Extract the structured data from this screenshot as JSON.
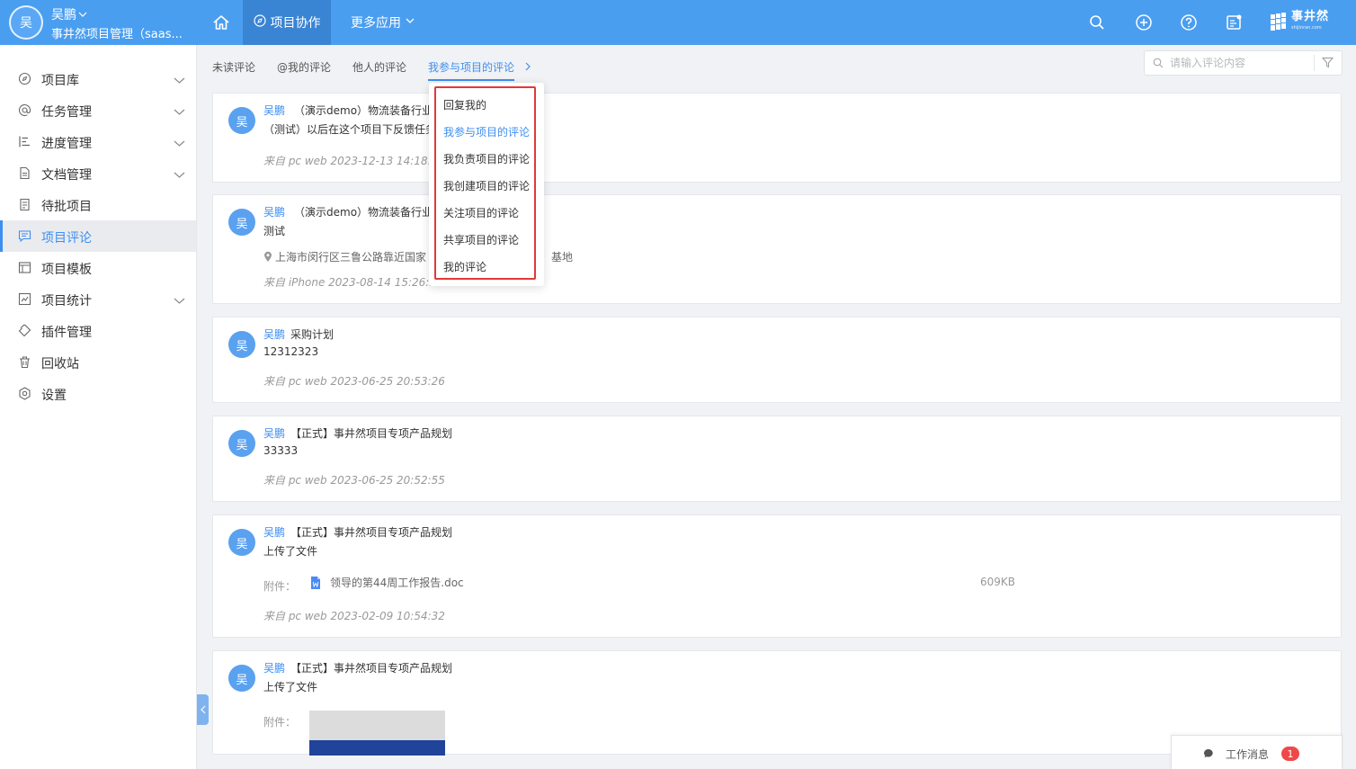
{
  "header": {
    "avatar_char": "吴",
    "user_name": "吴鹏",
    "org_name": "事井然项目管理（saas...",
    "nav_collab": "项目协作",
    "nav_more": "更多应用",
    "brand": "事井然",
    "brand_sub": "shijinran.com"
  },
  "sidebar": {
    "items": [
      {
        "label": "项目库",
        "icon": "compass-icon"
      },
      {
        "label": "任务管理",
        "icon": "at-icon"
      },
      {
        "label": "进度管理",
        "icon": "gantt-icon"
      },
      {
        "label": "文档管理",
        "icon": "document-icon"
      },
      {
        "label": "待批项目",
        "icon": "pending-icon"
      },
      {
        "label": "项目评论",
        "icon": "comment-icon"
      },
      {
        "label": "项目模板",
        "icon": "template-icon"
      },
      {
        "label": "项目统计",
        "icon": "chart-icon"
      },
      {
        "label": "插件管理",
        "icon": "plugin-icon"
      },
      {
        "label": "回收站",
        "icon": "trash-icon"
      },
      {
        "label": "设置",
        "icon": "settings-icon"
      }
    ]
  },
  "tabs": {
    "unread": "未读评论",
    "mentions": "@我的评论",
    "others": "他人的评论",
    "participating": "我参与项目的评论"
  },
  "search": {
    "placeholder": "请输入评论内容"
  },
  "dropdown": {
    "items": [
      "回复我的",
      "我参与项目的评论",
      "我负责项目的评论",
      "我创建项目的评论",
      "关注项目的评论",
      "共享项目的评论",
      "我的评论"
    ]
  },
  "comments": [
    {
      "avatar": "吴",
      "author": "吴鹏",
      "project": "（演示demo）物流装备行业R",
      "body": "（测试）以后在这个项目下反馈任务",
      "meta": "来自 pc web 2023-12-13 14:18:41"
    },
    {
      "avatar": "吴",
      "author": "吴鹏",
      "project": "（演示demo）物流装备行业R",
      "body": "测试",
      "location": "上海市闵行区三鲁公路靠近国家",
      "location_tail": "基地",
      "meta": "来自 iPhone 2023-08-14 15:26:36"
    },
    {
      "avatar": "吴",
      "author": "吴鹏",
      "project": "采购计划",
      "body": "12312323",
      "meta": "来自 pc web 2023-06-25 20:53:26"
    },
    {
      "avatar": "吴",
      "author": "吴鹏",
      "project": "【正式】事井然项目专项产品规划",
      "body": "33333",
      "meta": "来自 pc web 2023-06-25 20:52:55"
    },
    {
      "avatar": "吴",
      "author": "吴鹏",
      "project": "【正式】事井然项目专项产品规划",
      "body": "上传了文件",
      "attach_label": "附件：",
      "file_name": "领导的第44周工作报告.doc",
      "file_size": "609KB",
      "meta": "来自 pc web 2023-02-09 10:54:32"
    },
    {
      "avatar": "吴",
      "author": "吴鹏",
      "project": "【正式】事井然项目专项产品规划",
      "body": "上传了文件",
      "attach_label": "附件："
    }
  ],
  "work_msg": {
    "label": "工作消息",
    "count": "1"
  },
  "colors": {
    "primary": "#4a9ef0",
    "accent": "#3e8ef0",
    "highlight": "#e23838"
  }
}
